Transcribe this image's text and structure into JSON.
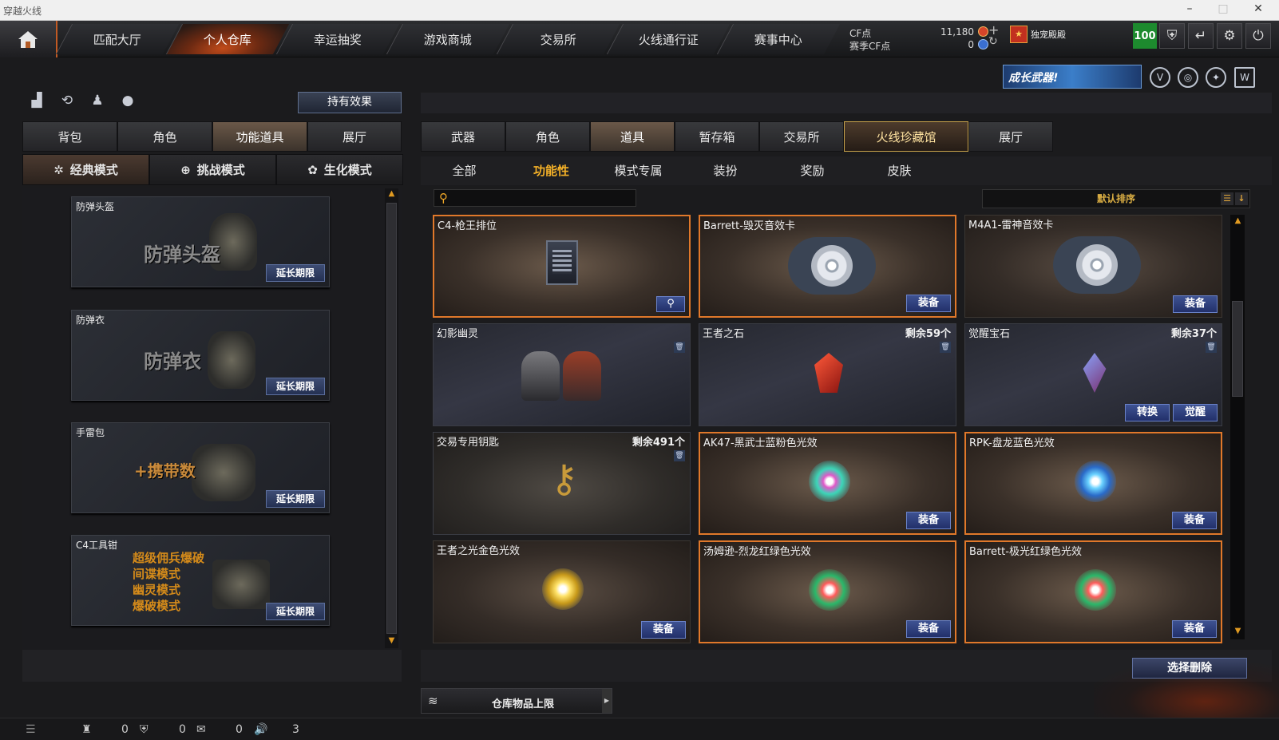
{
  "window": {
    "title": "穿越火线"
  },
  "nav": {
    "tabs": [
      "匹配大厅",
      "个人仓库",
      "幸运抽奖",
      "游戏商城",
      "交易所",
      "火线通行证",
      "赛事中心"
    ],
    "active": "个人仓库"
  },
  "currency": {
    "cf_label": "CF点",
    "cf_value": "11,180",
    "season_label": "赛季CF点",
    "season_value": "0"
  },
  "player": {
    "title": "独宠殿殿",
    "level": "100"
  },
  "top_icons": [
    "shield-icon",
    "share-icon",
    "gear-icon",
    "power-icon"
  ],
  "promo": {
    "label": "成长武器!"
  },
  "left": {
    "effect_button": "持有效果",
    "tabs": [
      "背包",
      "角色",
      "功能道具",
      "展厅"
    ],
    "active_tab": "功能道具",
    "modes": [
      {
        "icon": "classic-mode-icon",
        "label": "经典模式"
      },
      {
        "icon": "challenge-mode-icon",
        "label": "挑战模式"
      },
      {
        "icon": "biochem-mode-icon",
        "label": "生化模式"
      }
    ],
    "items": [
      {
        "name": "防弹头盔",
        "banner": "防弹头盔",
        "button": "延长期限"
      },
      {
        "name": "防弹衣",
        "banner": "防弹衣",
        "button": "延长期限"
      },
      {
        "name": "手雷包",
        "banner": "+携带数",
        "button": "延长期限"
      },
      {
        "name": "C4工具钳",
        "modes": [
          "超级佣兵爆破",
          "间谍模式",
          "幽灵模式",
          "爆破模式"
        ],
        "button": "延长期限"
      }
    ]
  },
  "right": {
    "tabs": [
      "武器",
      "角色",
      "道具",
      "暂存箱",
      "交易所",
      "火线珍藏馆",
      "展厅"
    ],
    "active_tab": "道具",
    "subtabs": [
      "全部",
      "功能性",
      "模式专属",
      "装扮",
      "奖励",
      "皮肤"
    ],
    "active_subtab": "功能性",
    "search_placeholder": "",
    "sort_label": "默认排序",
    "items": [
      {
        "name": "C4-枪王排位",
        "qty": "",
        "buttons": []
      },
      {
        "name": "Barrett-毁灭音效卡",
        "qty": "",
        "buttons": [
          "装备"
        ]
      },
      {
        "name": "M4A1-雷神音效卡",
        "qty": "",
        "buttons": [
          "装备"
        ]
      },
      {
        "name": "幻影幽灵",
        "qty": "",
        "buttons": []
      },
      {
        "name": "王者之石",
        "qty": "剩余59个",
        "buttons": []
      },
      {
        "name": "觉醒宝石",
        "qty": "剩余37个",
        "buttons": [
          "转换",
          "觉醒"
        ]
      },
      {
        "name": "交易专用钥匙",
        "qty": "剩余491个",
        "buttons": []
      },
      {
        "name": "AK47-黑武士蓝粉色光效",
        "qty": "",
        "buttons": [
          "装备"
        ]
      },
      {
        "name": "RPK-盘龙蓝色光效",
        "qty": "",
        "buttons": [
          "装备"
        ]
      },
      {
        "name": "王者之光金色光效",
        "qty": "",
        "buttons": [
          "装备"
        ]
      },
      {
        "name": "汤姆逊-烈龙红绿色光效",
        "qty": "",
        "buttons": [
          "装备"
        ]
      },
      {
        "name": "Barrett-极光红绿色光效",
        "qty": "",
        "buttons": [
          "装备"
        ]
      }
    ],
    "delete_button": "选择删除",
    "capacity_label": "仓库物品上限"
  },
  "statusbar": {
    "values": [
      "0",
      "0",
      "0",
      "3"
    ]
  },
  "colors": {
    "accent": "#e0782a",
    "button_blue": "#22306a",
    "gold": "#f4b128"
  }
}
